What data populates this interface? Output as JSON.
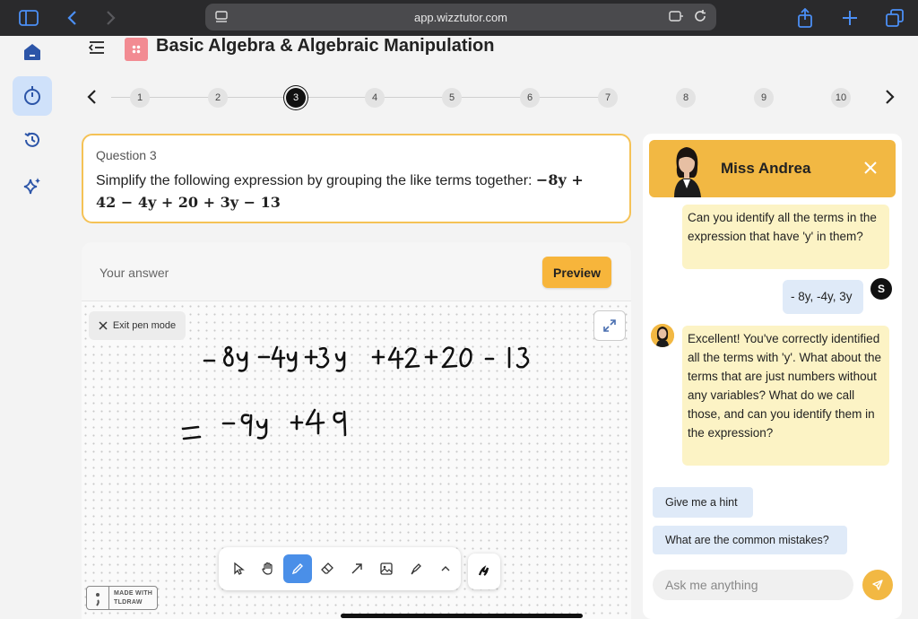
{
  "browser": {
    "url": "app.wizztutor.com"
  },
  "header": {
    "lesson_title": "Basic Algebra & Algebraic Manipulation"
  },
  "stepper": {
    "steps": [
      "1",
      "2",
      "3",
      "4",
      "5",
      "6",
      "7",
      "8",
      "9",
      "10"
    ],
    "current_step": "3"
  },
  "question": {
    "label": "Question 3",
    "prompt": "Simplify the following expression by grouping the like terms together:",
    "expression_line1": "−8y +",
    "expression_line2": "42 − 4y + 20 + 3y − 13"
  },
  "answer": {
    "label": "Your answer",
    "preview_label": "Preview",
    "exit_pen_label": "Exit pen mode",
    "handwriting_line1": "-8y -4y +3y +42+20-13",
    "handwriting_line2": "= -9y +49",
    "tldraw_badge_line1": "MADE WITH",
    "tldraw_badge_line2": "TLDRAW"
  },
  "toolbar": {
    "tools": [
      "select-tool",
      "hand-tool",
      "pen-tool",
      "eraser-tool",
      "arrow-tool",
      "image-tool",
      "highlighter-tool",
      "more-tools"
    ],
    "active_tool": "pen-tool"
  },
  "chat": {
    "tutor_name": "Miss Andrea",
    "user_initial": "S",
    "messages": [
      {
        "from": "tutor",
        "text": "Can you identify all the terms in the expression that have 'y' in them?"
      },
      {
        "from": "user",
        "text": "- 8y, -4y, 3y"
      },
      {
        "from": "tutor",
        "text": "Excellent! You've correctly identified all the terms with 'y'. What about the terms that are just numbers without any variables? What do we call those, and can you identify them in the expression?"
      }
    ],
    "suggestions": [
      "Give me a hint",
      "What are the common mistakes?"
    ],
    "input_placeholder": "Ask me anything"
  },
  "colors": {
    "accent_yellow": "#f2b843",
    "question_border": "#f5c256",
    "active_blue": "#4a8fe8",
    "tutor_bubble": "#fcf3c5",
    "user_bubble": "#dfeaf8"
  }
}
